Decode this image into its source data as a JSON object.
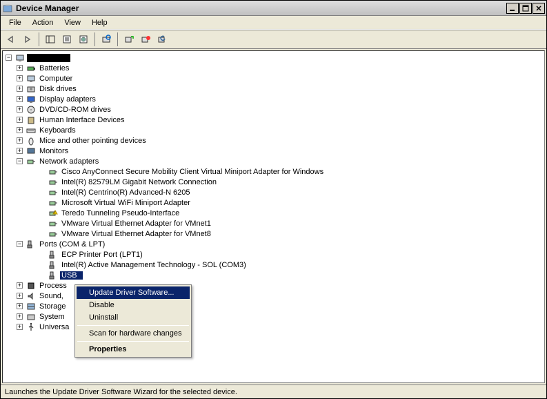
{
  "window": {
    "title": "Device Manager"
  },
  "menu": {
    "items": [
      "File",
      "Action",
      "View",
      "Help"
    ]
  },
  "tree": {
    "root_redacted": true,
    "categories": [
      {
        "label": "Batteries",
        "exp": "+",
        "icon": "battery"
      },
      {
        "label": "Computer",
        "exp": "+",
        "icon": "computer"
      },
      {
        "label": "Disk drives",
        "exp": "+",
        "icon": "disk"
      },
      {
        "label": "Display adapters",
        "exp": "+",
        "icon": "display"
      },
      {
        "label": "DVD/CD-ROM drives",
        "exp": "+",
        "icon": "dvd"
      },
      {
        "label": "Human Interface Devices",
        "exp": "+",
        "icon": "hid"
      },
      {
        "label": "Keyboards",
        "exp": "+",
        "icon": "keyboard"
      },
      {
        "label": "Mice and other pointing devices",
        "exp": "+",
        "icon": "mouse"
      },
      {
        "label": "Monitors",
        "exp": "+",
        "icon": "monitor"
      },
      {
        "label": "Network adapters",
        "exp": "-",
        "icon": "network",
        "children": [
          {
            "label": "Cisco AnyConnect Secure Mobility Client Virtual Miniport Adapter for Windows",
            "icon": "net"
          },
          {
            "label": "Intel(R) 82579LM Gigabit Network Connection",
            "icon": "net"
          },
          {
            "label": "Intel(R) Centrino(R) Advanced-N 6205",
            "icon": "net"
          },
          {
            "label": "Microsoft Virtual WiFi Miniport Adapter",
            "icon": "net"
          },
          {
            "label": "Teredo Tunneling Pseudo-Interface",
            "icon": "net-warn"
          },
          {
            "label": "VMware Virtual Ethernet Adapter for VMnet1",
            "icon": "net"
          },
          {
            "label": "VMware Virtual Ethernet Adapter for VMnet8",
            "icon": "net"
          }
        ]
      },
      {
        "label": "Ports (COM & LPT)",
        "exp": "-",
        "icon": "port",
        "children": [
          {
            "label": "ECP Printer Port (LPT1)",
            "icon": "port"
          },
          {
            "label": "Intel(R) Active Management Technology - SOL (COM3)",
            "icon": "port"
          },
          {
            "label": "USB",
            "icon": "port",
            "selected": true
          }
        ]
      },
      {
        "label": "Process",
        "exp": "+",
        "icon": "cpu",
        "truncated": true
      },
      {
        "label": "Sound,",
        "exp": "+",
        "icon": "sound",
        "truncated": true
      },
      {
        "label": "Storage",
        "exp": "+",
        "icon": "storage",
        "truncated": true
      },
      {
        "label": "System",
        "exp": "+",
        "icon": "system",
        "truncated": true
      },
      {
        "label": "Universa",
        "exp": "+",
        "icon": "usb",
        "truncated": true
      }
    ]
  },
  "contextMenu": {
    "items": [
      {
        "label": "Update Driver Software...",
        "highlighted": true
      },
      {
        "label": "Disable"
      },
      {
        "label": "Uninstall"
      },
      {
        "sep": true
      },
      {
        "label": "Scan for hardware changes"
      },
      {
        "sep": true
      },
      {
        "label": "Properties",
        "bold": true
      }
    ]
  },
  "statusbar": {
    "text": "Launches the Update Driver Software Wizard for the selected device."
  }
}
